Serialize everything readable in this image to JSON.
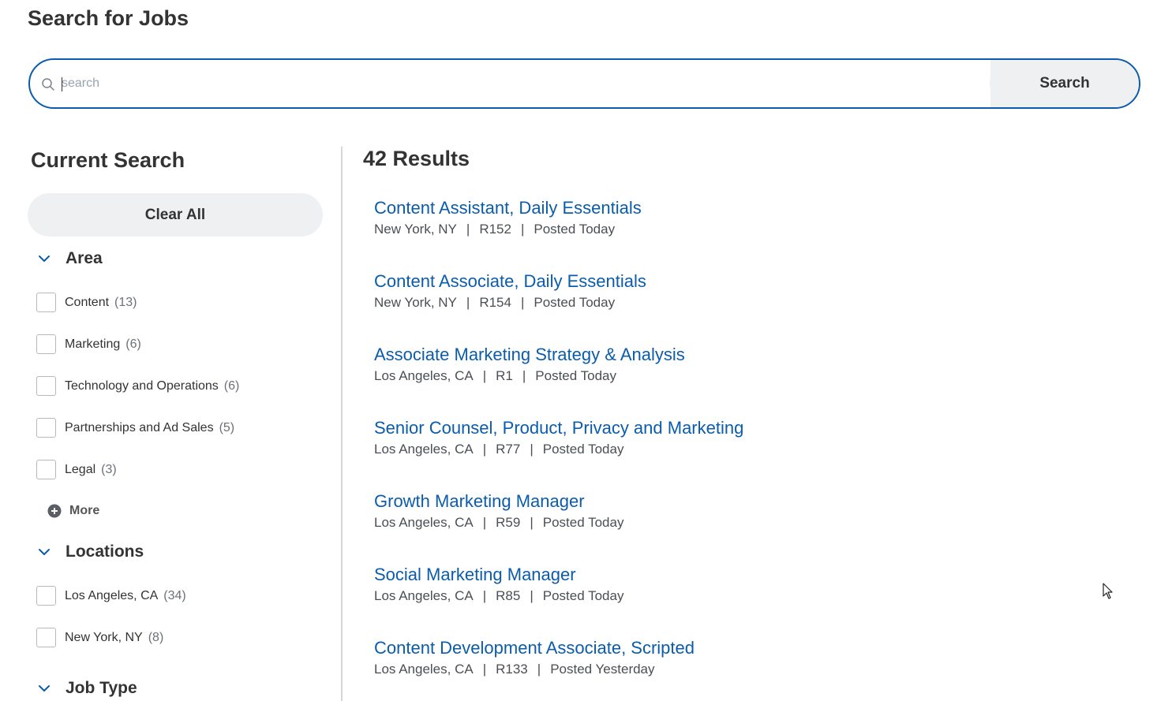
{
  "page_title": "Search for Jobs",
  "search": {
    "placeholder": "search",
    "value": "",
    "button_label": "Search"
  },
  "sidebar": {
    "title": "Current Search",
    "clear_all_label": "Clear All",
    "facets": {
      "area": {
        "title": "Area",
        "options": [
          {
            "label": "Content",
            "count": "(13)"
          },
          {
            "label": "Marketing",
            "count": "(6)"
          },
          {
            "label": "Technology and Operations",
            "count": "(6)"
          },
          {
            "label": "Partnerships and Ad Sales",
            "count": "(5)"
          },
          {
            "label": "Legal",
            "count": "(3)"
          }
        ],
        "more_label": "More"
      },
      "locations": {
        "title": "Locations",
        "options": [
          {
            "label": "Los Angeles, CA",
            "count": "(34)"
          },
          {
            "label": "New York, NY",
            "count": "(8)"
          }
        ]
      },
      "job_type": {
        "title": "Job Type"
      }
    }
  },
  "results": {
    "count_label": "42 Results",
    "jobs": [
      {
        "title": "Content Assistant, Daily Essentials",
        "location": "New York, NY",
        "req": "R152",
        "posted": "Posted Today"
      },
      {
        "title": "Content Associate, Daily Essentials",
        "location": "New York, NY",
        "req": "R154",
        "posted": "Posted Today"
      },
      {
        "title": "Associate Marketing Strategy & Analysis",
        "location": "Los Angeles, CA",
        "req": "R1",
        "posted": "Posted Today"
      },
      {
        "title": "Senior Counsel, Product, Privacy and Marketing",
        "location": "Los Angeles, CA",
        "req": "R77",
        "posted": "Posted Today"
      },
      {
        "title": "Growth Marketing Manager",
        "location": "Los Angeles, CA",
        "req": "R59",
        "posted": "Posted Today"
      },
      {
        "title": "Social Marketing Manager",
        "location": "Los Angeles, CA",
        "req": "R85",
        "posted": "Posted Today"
      },
      {
        "title": "Content Development Associate, Scripted",
        "location": "Los Angeles, CA",
        "req": "R133",
        "posted": "Posted Yesterday"
      }
    ],
    "separator": "|"
  },
  "colors": {
    "accent": "#0b5cab",
    "button_bg": "#eef0f2",
    "text": "#333333"
  },
  "icons": [
    "search-icon",
    "chevron-down-icon",
    "plus-circle-icon",
    "mouse-pointer-icon"
  ]
}
